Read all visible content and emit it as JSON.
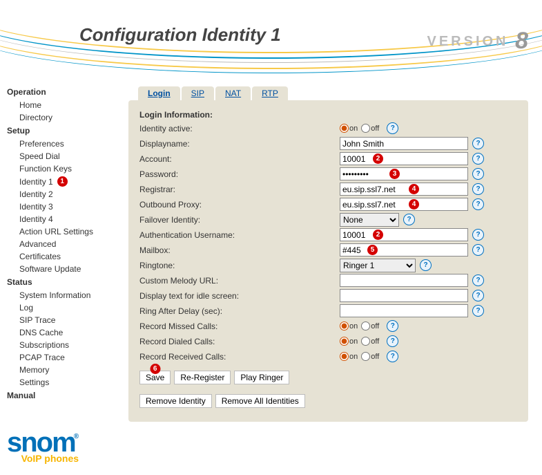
{
  "header": {
    "title": "Configuration Identity 1",
    "version_word": "VERSION",
    "version_num": "8"
  },
  "sidebar": {
    "operation": {
      "title": "Operation",
      "items": [
        {
          "label": "Home",
          "name": "nav-home"
        },
        {
          "label": "Directory",
          "name": "nav-directory"
        }
      ]
    },
    "setup": {
      "title": "Setup",
      "items": [
        {
          "label": "Preferences",
          "name": "nav-preferences"
        },
        {
          "label": "Speed Dial",
          "name": "nav-speed-dial"
        },
        {
          "label": "Function Keys",
          "name": "nav-function-keys"
        },
        {
          "label": "Identity 1",
          "name": "nav-identity-1",
          "badge": "1",
          "active": true
        },
        {
          "label": "Identity 2",
          "name": "nav-identity-2"
        },
        {
          "label": "Identity 3",
          "name": "nav-identity-3"
        },
        {
          "label": "Identity 4",
          "name": "nav-identity-4"
        },
        {
          "label": "Action URL Settings",
          "name": "nav-action-url"
        },
        {
          "label": "Advanced",
          "name": "nav-advanced"
        },
        {
          "label": "Certificates",
          "name": "nav-certificates"
        },
        {
          "label": "Software Update",
          "name": "nav-software-update"
        }
      ]
    },
    "status": {
      "title": "Status",
      "items": [
        {
          "label": "System Information",
          "name": "nav-sys-info"
        },
        {
          "label": "Log",
          "name": "nav-log"
        },
        {
          "label": "SIP Trace",
          "name": "nav-sip-trace"
        },
        {
          "label": "DNS Cache",
          "name": "nav-dns-cache"
        },
        {
          "label": "Subscriptions",
          "name": "nav-subscriptions"
        },
        {
          "label": "PCAP Trace",
          "name": "nav-pcap-trace"
        },
        {
          "label": "Memory",
          "name": "nav-memory"
        },
        {
          "label": "Settings",
          "name": "nav-settings"
        }
      ]
    },
    "manual": {
      "title": "Manual"
    }
  },
  "logo": {
    "brand": "snom",
    "tag": "VoIP phones"
  },
  "tabs": [
    {
      "label": "Login",
      "name": "tab-login",
      "active": true
    },
    {
      "label": "SIP",
      "name": "tab-sip"
    },
    {
      "label": "NAT",
      "name": "tab-nat"
    },
    {
      "label": "RTP",
      "name": "tab-rtp"
    }
  ],
  "form": {
    "section_title": "Login Information:",
    "identity_active": {
      "label": "Identity active:",
      "on": "on",
      "off": "off",
      "value": "on"
    },
    "displayname": {
      "label": "Displayname:",
      "value": "John Smith"
    },
    "account": {
      "label": "Account:",
      "value": "10001",
      "badge": "2"
    },
    "password": {
      "label": "Password:",
      "value": "•••••••••",
      "badge": "3"
    },
    "registrar": {
      "label": "Registrar:",
      "value": "eu.sip.ssl7.net",
      "badge": "4"
    },
    "outbound_proxy": {
      "label": "Outbound Proxy:",
      "value": "eu.sip.ssl7.net",
      "badge": "4"
    },
    "failover": {
      "label": "Failover Identity:",
      "value": "None"
    },
    "auth_user": {
      "label": "Authentication Username:",
      "value": "10001",
      "badge": "2"
    },
    "mailbox": {
      "label": "Mailbox:",
      "value": "#445",
      "badge": "5"
    },
    "ringtone": {
      "label": "Ringtone:",
      "value": "Ringer 1"
    },
    "custom_melody": {
      "label": "Custom Melody URL:",
      "value": ""
    },
    "idle_text": {
      "label": "Display text for idle screen:",
      "value": ""
    },
    "ring_delay": {
      "label": "Ring After Delay (sec):",
      "value": ""
    },
    "rec_missed": {
      "label": "Record Missed Calls:",
      "on": "on",
      "off": "off",
      "value": "on"
    },
    "rec_dialed": {
      "label": "Record Dialed Calls:",
      "on": "on",
      "off": "off",
      "value": "on"
    },
    "rec_received": {
      "label": "Record Received Calls:",
      "on": "on",
      "off": "off",
      "value": "on"
    }
  },
  "buttons": {
    "save": "Save",
    "save_badge": "6",
    "reregister": "Re-Register",
    "play_ringer": "Play Ringer",
    "remove_identity": "Remove Identity",
    "remove_all": "Remove All Identities"
  }
}
